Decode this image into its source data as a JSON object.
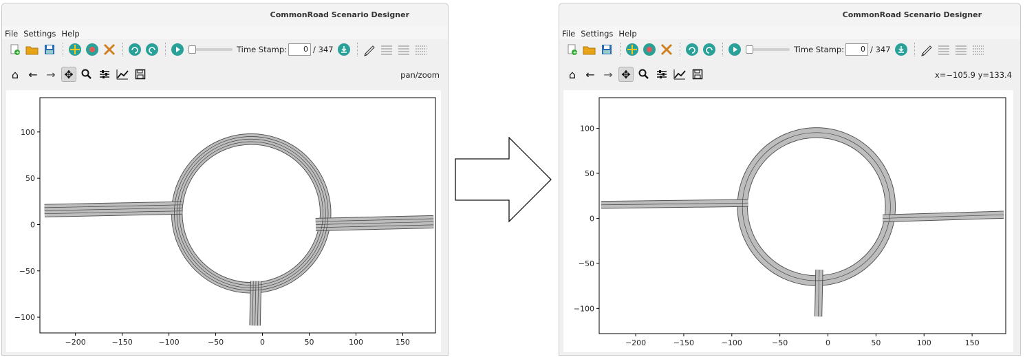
{
  "app": {
    "title": "CommonRoad Scenario Designer"
  },
  "menu": [
    "File",
    "Settings",
    "Help"
  ],
  "toolbar": {
    "icons": [
      "new-file-icon",
      "open-folder-icon",
      "save-icon",
      "add-lanelet-icon",
      "toggle-view-icon",
      "tools-icon",
      "undo-icon",
      "redo-icon",
      "play-icon"
    ],
    "timestamp_label": "Time Stamp:",
    "timestamp_value": "0",
    "timestamp_total": "/ 347",
    "trailing_icons": [
      "export-icon",
      "edit-icon",
      "align-left-icon",
      "align-center-icon",
      "align-justify-icon"
    ]
  },
  "navbar_icons": [
    "home-icon",
    "back-icon",
    "forward-icon",
    "pan-icon",
    "zoom-icon",
    "configure-subplots-icon",
    "edit-axis-icon",
    "save-figure-icon"
  ],
  "left": {
    "status": "pan/zoom"
  },
  "right": {
    "status": "x=−105.9 y=133.4"
  },
  "chart_data": [
    {
      "type": "scatter",
      "description_free": true,
      "xlim": [
        -238,
        185
      ],
      "ylim": [
        -117,
        137
      ],
      "xticks": [
        -200,
        -150,
        -100,
        -50,
        0,
        50,
        100,
        150
      ],
      "yticks": [
        -100,
        -50,
        0,
        50,
        100
      ],
      "xtick_labels": [
        "−200",
        "−150",
        "−100",
        "−50",
        "0",
        "50",
        "100",
        "150"
      ],
      "ytick_labels": [
        "−100",
        "−50",
        "0",
        "50",
        "100"
      ],
      "roundabout": {
        "center": [
          -12,
          12
        ],
        "radius_outer": 85,
        "radius_inner": 74
      },
      "roads": [
        {
          "from": [
            -233,
            15
          ],
          "to": [
            -86,
            18
          ],
          "width": 13
        },
        {
          "from": [
            57,
            0
          ],
          "to": [
            183,
            3
          ],
          "width": 13
        },
        {
          "from": [
            -7,
            -61
          ],
          "to": [
            -8,
            -109
          ],
          "width": 11
        }
      ],
      "lane_lines": 3
    },
    {
      "type": "scatter",
      "xlim": [
        -238,
        185
      ],
      "ylim": [
        -128,
        134
      ],
      "xticks": [
        -200,
        -150,
        -100,
        -50,
        0,
        50,
        100,
        150
      ],
      "yticks": [
        -100,
        -50,
        0,
        50,
        100
      ],
      "xtick_labels": [
        "−200",
        "−150",
        "−100",
        "−50",
        "0",
        "50",
        "100",
        "150"
      ],
      "ytick_labels": [
        "−100",
        "−50",
        "0",
        "50",
        "100"
      ],
      "roundabout": {
        "center": [
          -12,
          13
        ],
        "radius_outer": 82,
        "radius_inner": 72
      },
      "roads": [
        {
          "from": [
            -236,
            15
          ],
          "to": [
            -83,
            17
          ],
          "width": 7
        },
        {
          "from": [
            57,
            0
          ],
          "to": [
            183,
            4
          ],
          "width": 7
        },
        {
          "from": [
            -9,
            -57
          ],
          "to": [
            -10,
            -109
          ],
          "width": 7
        }
      ],
      "lane_lines": 1
    }
  ]
}
